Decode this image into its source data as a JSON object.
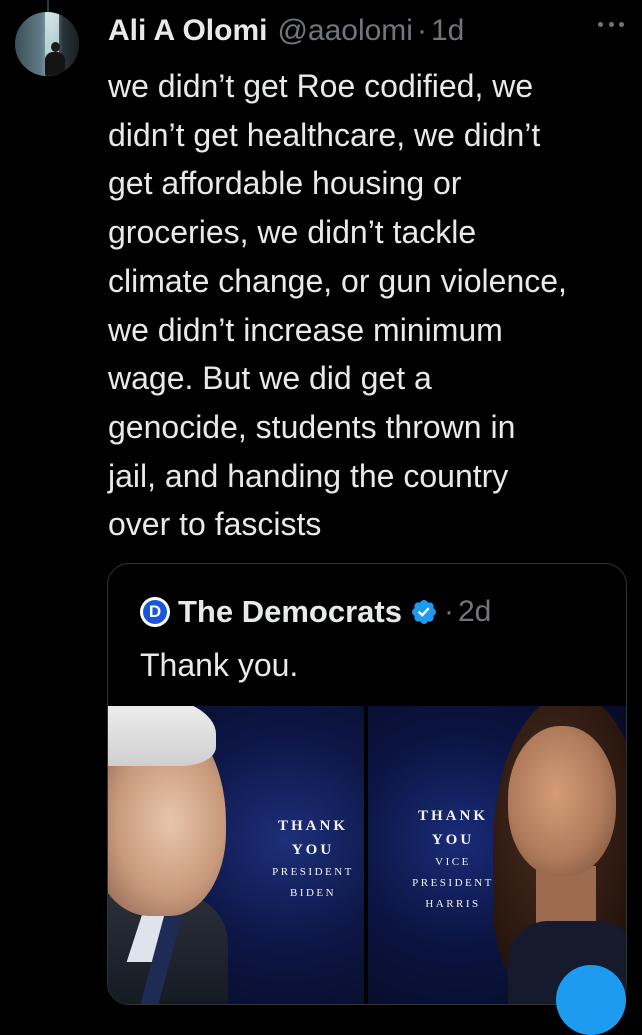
{
  "tweet": {
    "author_name": "Ali A Olomi",
    "handle": "@aaolomi",
    "separator": "·",
    "time": "1d",
    "text": "we didn’t get Roe codified, we\ndidn’t get healthcare, we didn’t\nget affordable housing or\ngroceries, we didn’t tackle\nclimate change, or gun violence,\nwe didn’t increase minimum\nwage. But we did get a\ngenocide, students thrown in\njail, and handing the country\nover to fascists"
  },
  "quoted_tweet": {
    "logo_letter": "D",
    "author_name": "The Democrats",
    "separator": "·",
    "time": "2d",
    "text": "Thank you.",
    "media": {
      "left": {
        "line1": "THANK",
        "line2": "YOU",
        "line3": "PRESIDENT",
        "line4": "BIDEN"
      },
      "right": {
        "line1": "THANK",
        "line2": "YOU",
        "line3": "VICE",
        "line4": "PRESIDENT",
        "line5": "HARRIS"
      }
    }
  },
  "colors": {
    "background": "#000000",
    "text_primary": "#e7e9ea",
    "text_secondary": "#71767b",
    "verified_blue": "#1d9bf0",
    "border": "#2f3336"
  },
  "icons": [
    "more-icon",
    "verified-badge-icon",
    "democrats-logo-icon"
  ]
}
